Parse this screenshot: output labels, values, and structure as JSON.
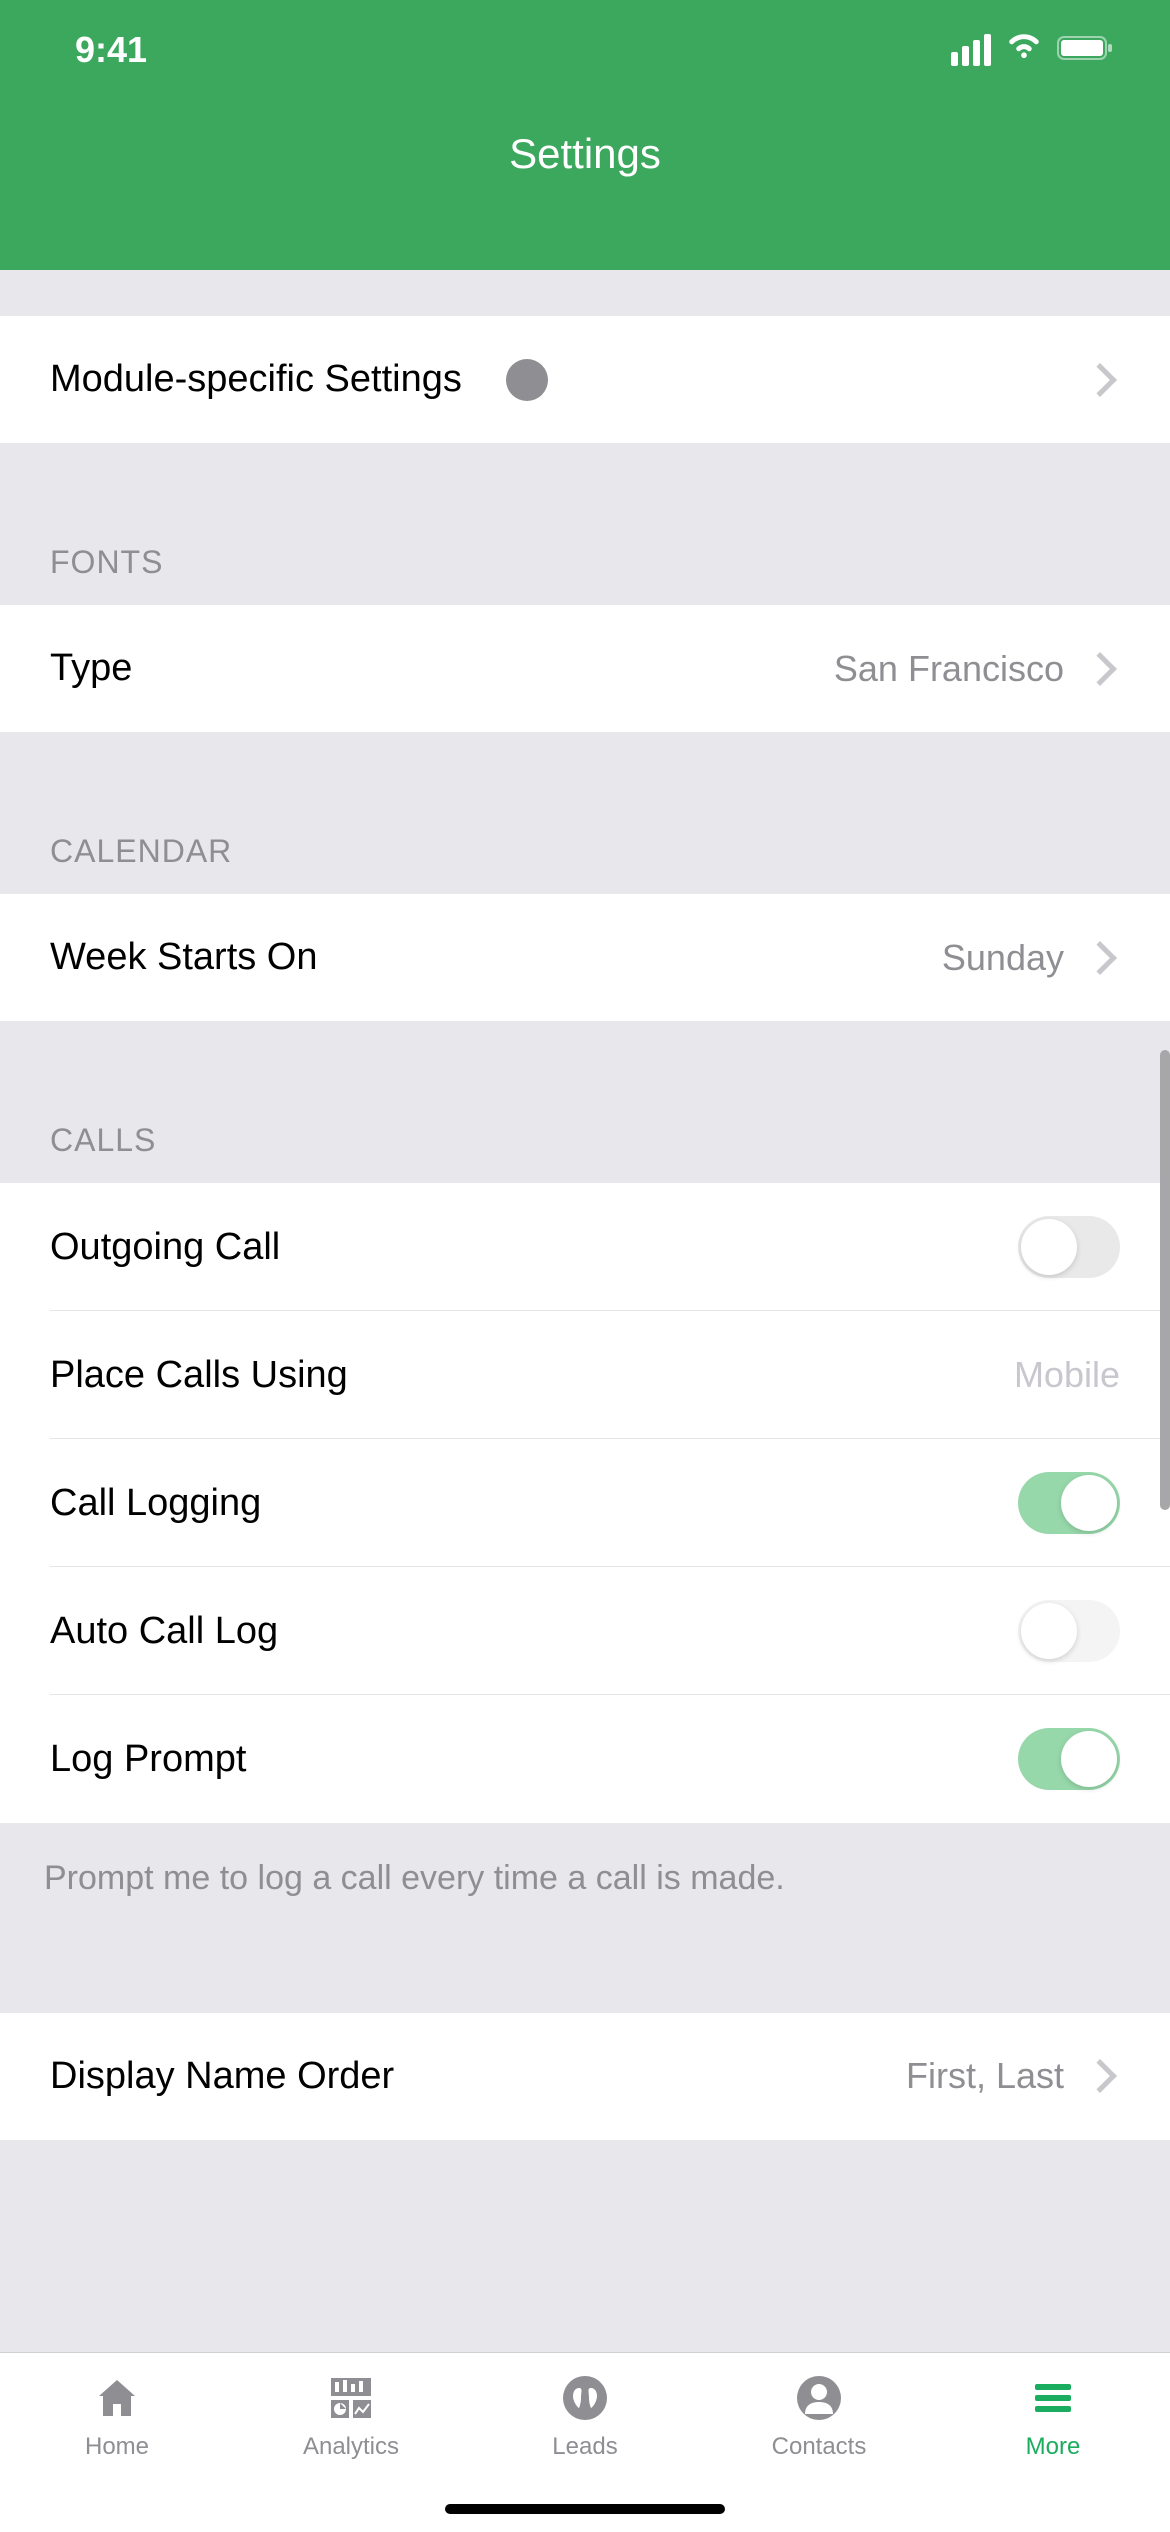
{
  "statusBar": {
    "time": "9:41"
  },
  "header": {
    "title": "Settings"
  },
  "rows": {
    "moduleSpecific": {
      "label": "Module-specific Settings"
    },
    "fontsHeader": "FONTS",
    "fontType": {
      "label": "Type",
      "value": "San Francisco"
    },
    "calendarHeader": "CALENDAR",
    "weekStarts": {
      "label": "Week Starts On",
      "value": "Sunday"
    },
    "callsHeader": "CALLS",
    "outgoingCall": {
      "label": "Outgoing Call"
    },
    "placeCalls": {
      "label": "Place Calls Using",
      "value": "Mobile"
    },
    "callLogging": {
      "label": "Call Logging"
    },
    "autoCallLog": {
      "label": "Auto Call Log"
    },
    "logPrompt": {
      "label": "Log Prompt"
    },
    "footerText": "Prompt me to log a call every time a call is made.",
    "displayName": {
      "label": "Display Name Order",
      "value": "First, Last"
    }
  },
  "tabs": {
    "home": "Home",
    "analytics": "Analytics",
    "leads": "Leads",
    "contacts": "Contacts",
    "more": "More"
  }
}
